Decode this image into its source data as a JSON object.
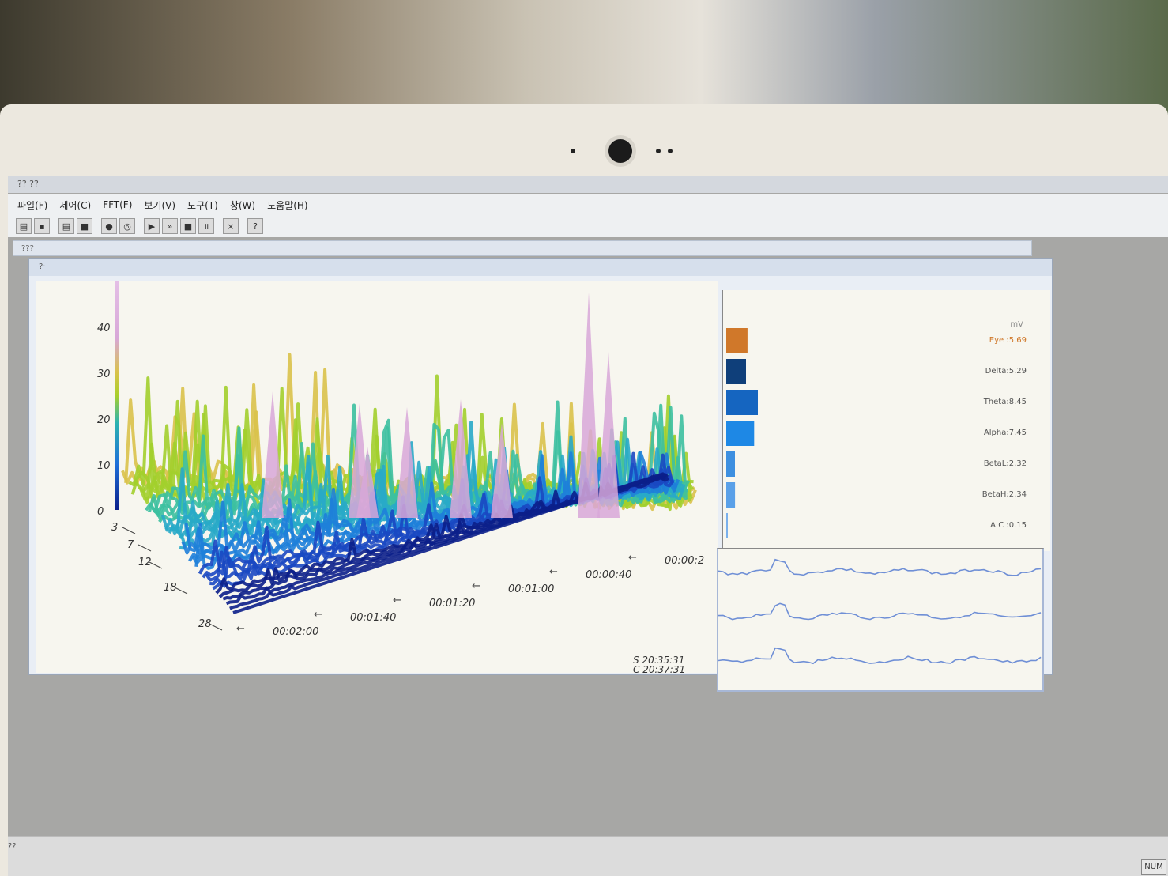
{
  "window": {
    "title": "?? ??",
    "child_title": "???",
    "inner_title": "?·"
  },
  "menu": [
    "파일(F)",
    "제어(C)",
    "FFT(F)",
    "보기(V)",
    "도구(T)",
    "창(W)",
    "도움말(H)"
  ],
  "toolbar": {
    "close_glyph": "×",
    "help_glyph": "?"
  },
  "chart_data": {
    "type": "3d-surface",
    "z_ticks": [
      "0",
      "10",
      "20",
      "30",
      "40"
    ],
    "freq_ticks": [
      "3",
      "7",
      "12",
      "18",
      "28"
    ],
    "time_ticks": [
      "00:02:00",
      "00:01:40",
      "00:01:20",
      "00:01:00",
      "00:00:40",
      "00:00:2"
    ],
    "start_time": "S 20:35:31",
    "current_time": "C 20:37:31"
  },
  "bands": {
    "unit": "mV",
    "items": [
      {
        "label": "Eye :5.69",
        "value": 5.69,
        "color": "#d0782a"
      },
      {
        "label": "Delta:5.29",
        "value": 5.29,
        "color": "#0f3f7a"
      },
      {
        "label": "Theta:8.45",
        "value": 8.45,
        "color": "#1565c0"
      },
      {
        "label": "Alpha:7.45",
        "value": 7.45,
        "color": "#1e88e5"
      },
      {
        "label": "BetaL:2.32",
        "value": 2.32,
        "color": "#3d8fe0"
      },
      {
        "label": "BetaH:2.34",
        "value": 2.34,
        "color": "#5aa0e8"
      },
      {
        "label": "A C :0.15",
        "value": 0.15,
        "color": "#7ab0ec"
      }
    ]
  },
  "status": {
    "left": "??",
    "num": "NUM"
  }
}
